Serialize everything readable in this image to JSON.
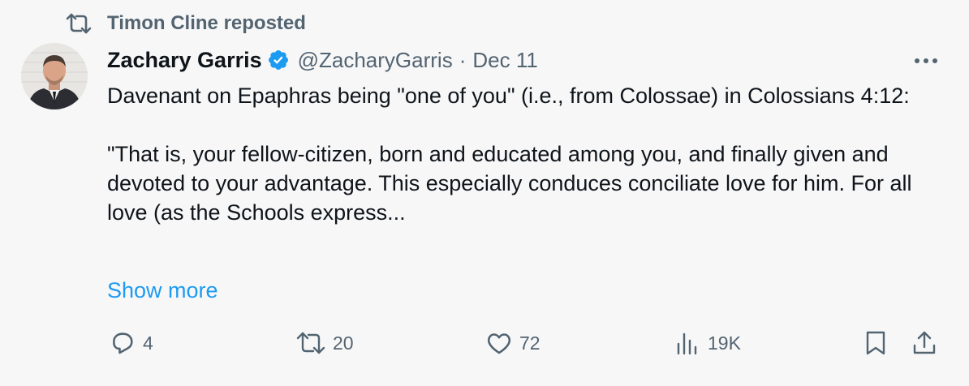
{
  "repost": {
    "text": "Timon Cline reposted",
    "icon": "repost-icon"
  },
  "author": {
    "name": "Zachary Garris",
    "handle": "@ZacharyGarris",
    "separator": "·",
    "date": "Dec 11",
    "verified": true
  },
  "tweet": {
    "paragraphs": [
      "Davenant on Epaphras being \"one of you\" (i.e., from Colossae) in Colossians 4:12:",
      "\"That is, your fellow-citizen, born and educated among you, and finally given and devoted to your advantage. This especially conduces conciliate love for him. For all love (as the Schools express..."
    ],
    "show_more": "Show more"
  },
  "actions": {
    "replies": "4",
    "reposts": "20",
    "likes": "72",
    "views": "19K"
  },
  "colors": {
    "background": "#f7f7f8",
    "text": "#0f1419",
    "secondary": "#536471",
    "accent": "#1d9bf0"
  }
}
